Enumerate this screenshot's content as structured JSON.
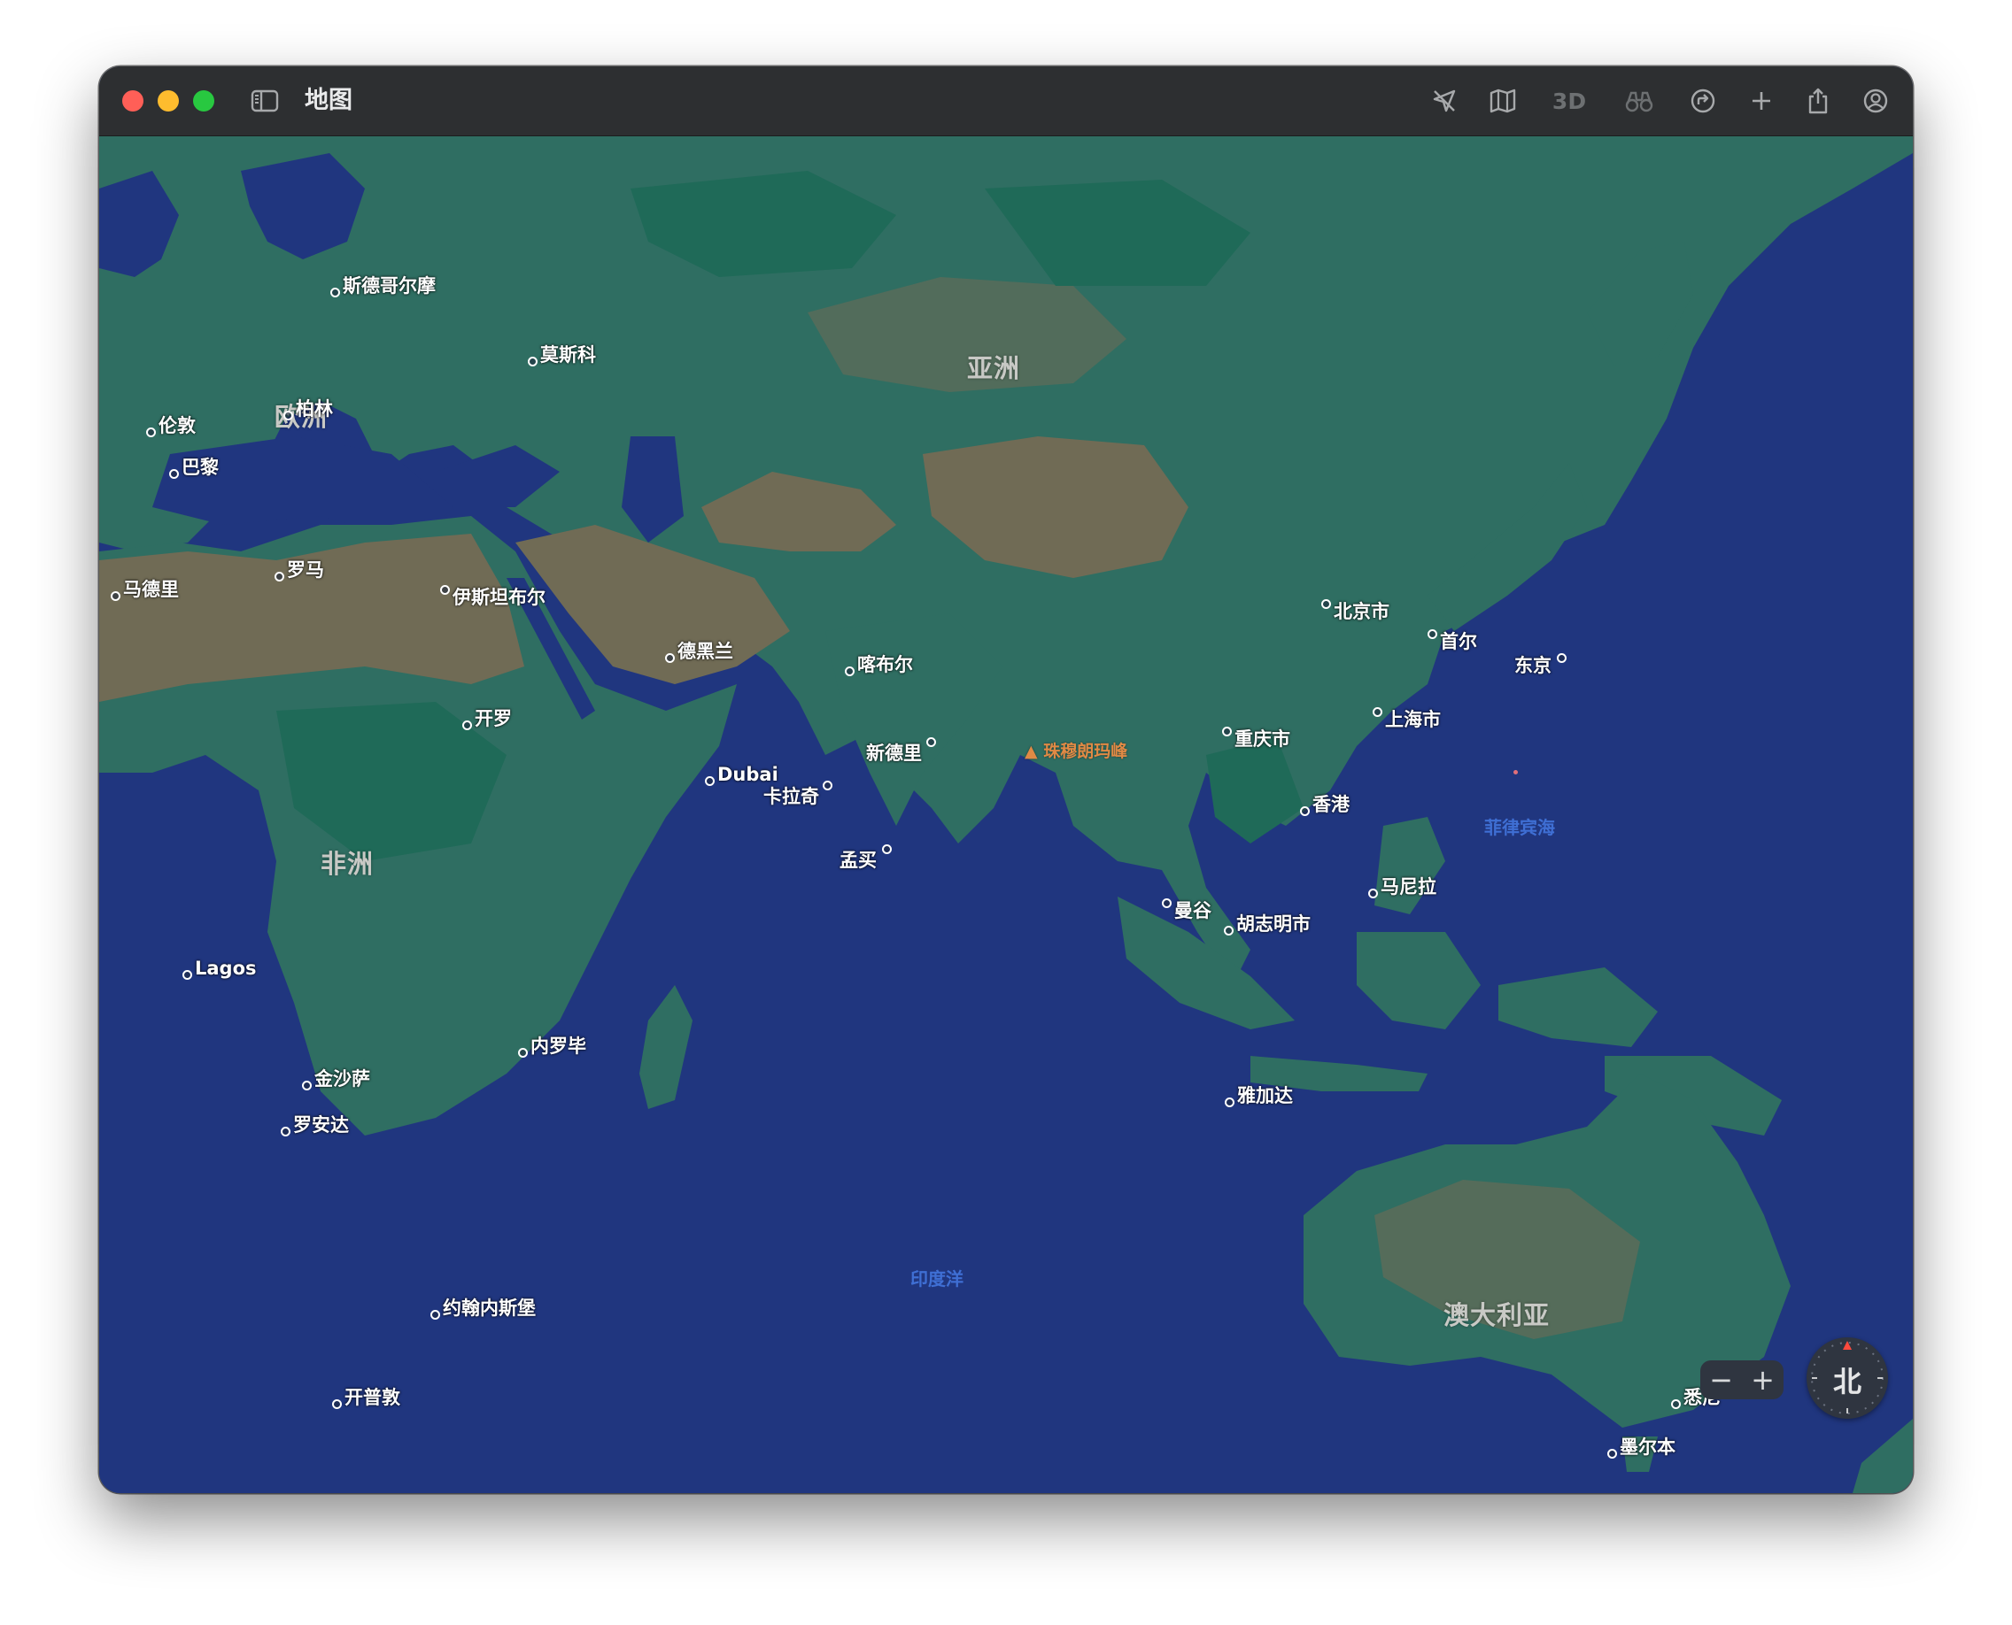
{
  "window": {
    "title": "地图"
  },
  "toolbar": {
    "icons": [
      "sidebar-icon",
      "location-arrow-icon",
      "map-icon",
      "binoculars-icon",
      "directions-icon",
      "plus-icon",
      "share-icon",
      "account-icon"
    ],
    "three_d_label": "3D"
  },
  "map": {
    "continents": {
      "asia": "亚洲",
      "europe": "欧洲",
      "africa": "非洲",
      "australia": "澳大利亚"
    },
    "oceans": {
      "indian": "印度洋",
      "philippine": "菲律宾海"
    },
    "peak": {
      "everest": "珠穆朗玛峰"
    },
    "cities": {
      "stockholm": "斯德哥尔摩",
      "moscow": "莫斯科",
      "berlin": "柏林",
      "london": "伦敦",
      "paris": "巴黎",
      "rome": "罗马",
      "madrid": "马德里",
      "istanbul": "伊斯坦布尔",
      "tehran": "德黑兰",
      "kabul": "喀布尔",
      "cairo": "开罗",
      "dubai": "Dubai",
      "karachi": "卡拉奇",
      "new_delhi": "新德里",
      "mumbai": "孟买",
      "beijing": "北京市",
      "seoul": "首尔",
      "tokyo": "东京",
      "shanghai": "上海市",
      "chongqing": "重庆市",
      "hong_kong": "香港",
      "manila": "马尼拉",
      "bangkok": "曼谷",
      "ho_chi_minh": "胡志明市",
      "jakarta": "雅加达",
      "lagos": "Lagos",
      "nairobi": "内罗毕",
      "kinshasa": "金沙萨",
      "luanda": "罗安达",
      "johannesburg": "约翰内斯堡",
      "cape_town": "开普敦",
      "sydney": "悉尼",
      "melbourne": "墨尔本"
    }
  },
  "controls": {
    "zoom_out": "−",
    "zoom_in": "+",
    "compass_label": "北"
  },
  "colors": {
    "ocean": "#20367f",
    "land": "#2f6e62",
    "desert": "#706b55",
    "forest": "#1f6a58",
    "peak_label": "#e08a45"
  }
}
